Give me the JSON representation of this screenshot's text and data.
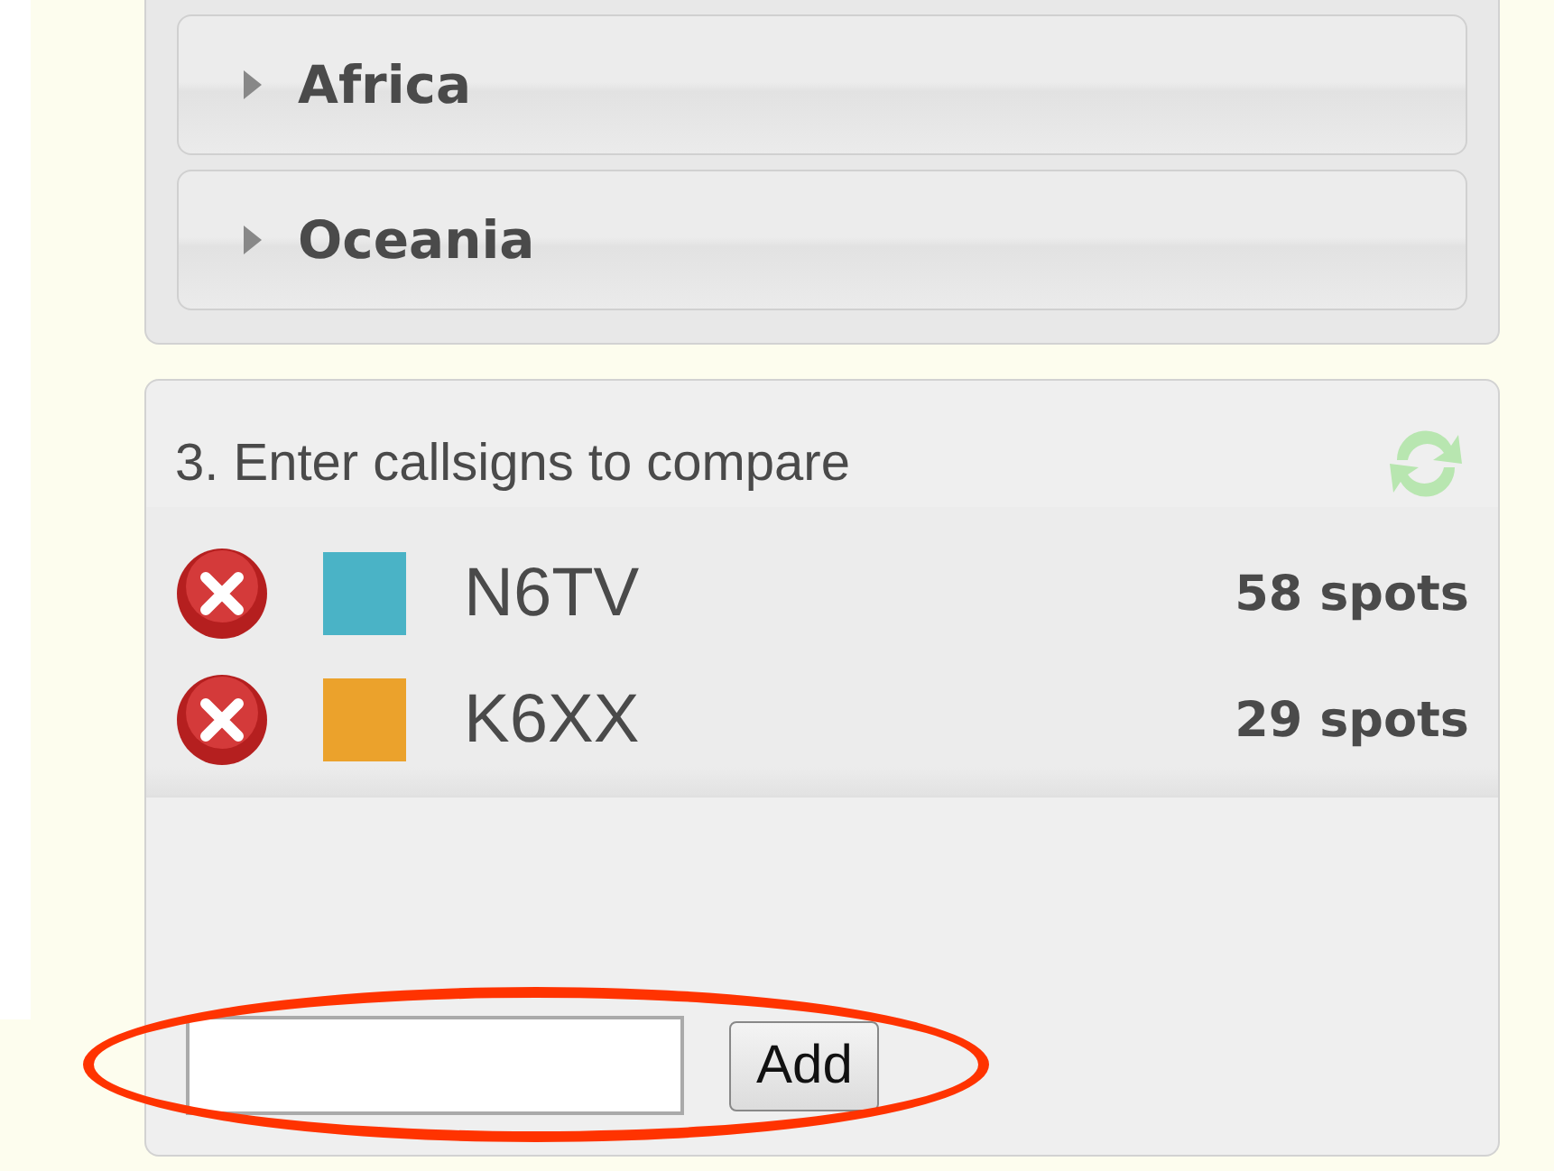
{
  "regions": [
    {
      "label": "Africa",
      "expanded": false
    },
    {
      "label": "Oceania",
      "expanded": false
    }
  ],
  "compare": {
    "title": "3. Enter callsigns to compare",
    "callsigns": [
      {
        "call": "N6TV",
        "color": "#4ab3c6",
        "spots": "58 spots"
      },
      {
        "call": "K6XX",
        "color": "#eba22c",
        "spots": "29 spots"
      }
    ],
    "add_button": "Add"
  }
}
